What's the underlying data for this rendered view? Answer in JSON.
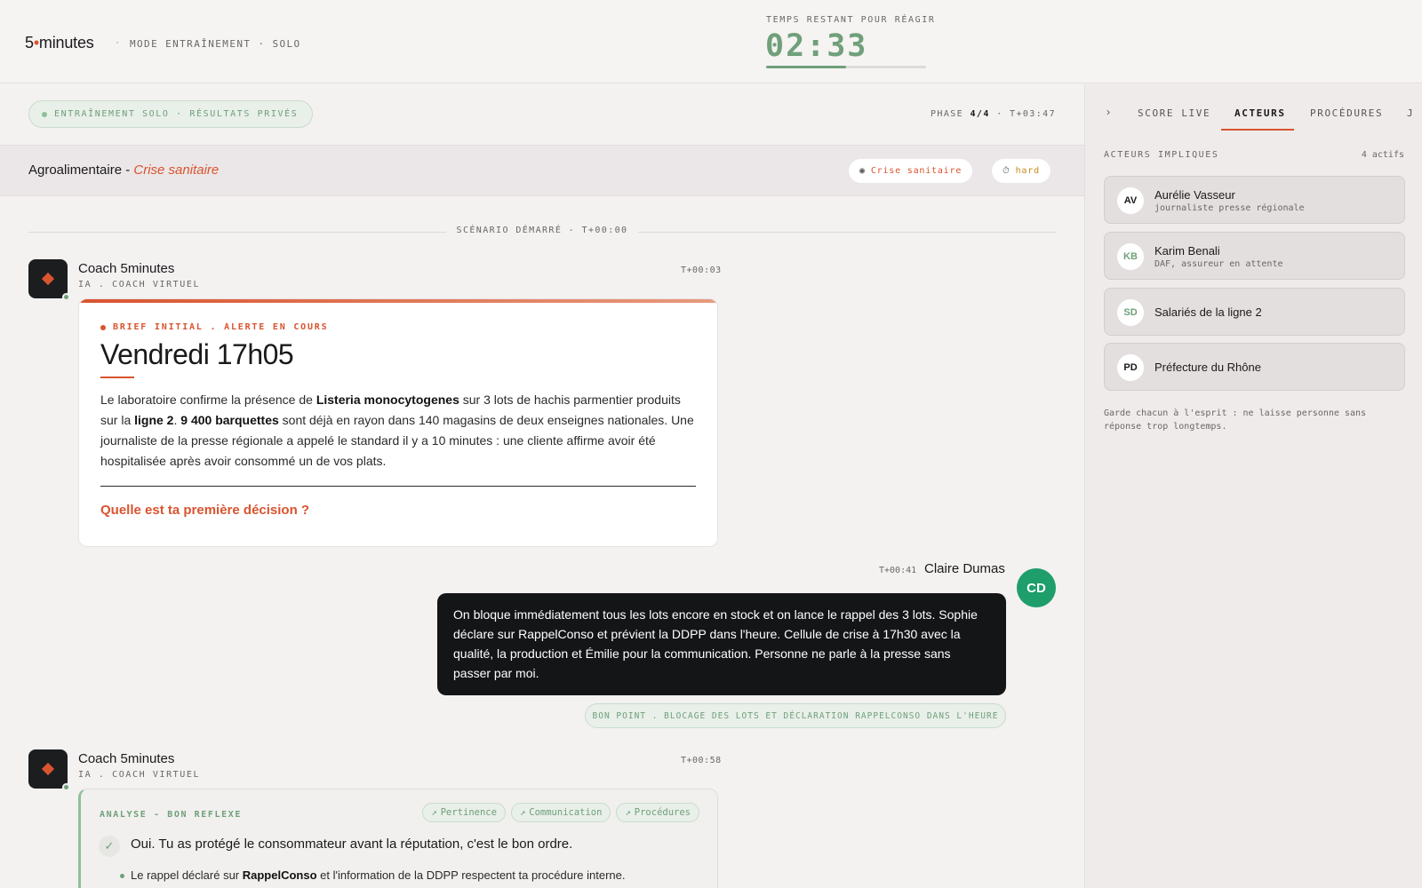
{
  "header": {
    "logo_num": "5",
    "logo_word": "minutes",
    "separator": "·",
    "mode": "MODE ENTRAÎNEMENT · SOLO",
    "timer_label": "TEMPS RESTANT POUR RÉAGIR",
    "timer": "02:33",
    "timer_progress": 0.5
  },
  "subheader": {
    "solo_pill": "ENTRAÎNEMENT SOLO · RÉSULTATS PRIVÉS",
    "phase_label": "PHASE",
    "phase_value": "4/4",
    "phase_time": "· T+03:47"
  },
  "scenario": {
    "sector": "Agroalimentaire - ",
    "crisis": "Crise sanitaire",
    "chip_crise": "Crise sanitaire",
    "chip_hard": "hard"
  },
  "chat": {
    "divider": "SCÉNARIO DÉMARRÉ - T+00:00",
    "coach_name": "Coach 5minutes",
    "coach_sub": "IA . COACH VIRTUEL",
    "msg1_ts": "T+00:03",
    "brief": {
      "label": "BRIEF INITIAL . ALERTE EN COURS",
      "title": "Vendredi 17h05",
      "t1": "Le laboratoire confirme la présence de ",
      "b1": "Listeria monocytogenes",
      "t2": " sur 3 lots de hachis parmentier produits sur la ",
      "b2": "ligne 2",
      "t3": ". ",
      "b3": "9 400 barquettes",
      "t4": " sont déjà en rayon dans 140 magasins de deux enseignes nationales. Une journaliste de la presse régionale a appelé le standard il y a 10 minutes : une cliente affirme avoir été hospitalisée après avoir consommé un de vos plats.",
      "question": "Quelle est ta première décision ?"
    },
    "user_ts": "T+00:41",
    "user_name": "Claire Dumas",
    "user_initials": "CD",
    "user_message": "On bloque immédiatement tous les lots encore en stock et on lance le rappel des 3 lots. Sophie déclare sur RappelConso et prévient la DDPP dans l'heure. Cellule de crise à 17h30 avec la qualité, la production et Émilie pour la communication. Personne ne parle à la presse sans passer par moi.",
    "bon_point": "BON POINT . BLOCAGE DES LOTS ET DÉCLARATION RAPPELCONSO DANS L'HEURE",
    "msg2_ts": "T+00:58",
    "analyse": {
      "label": "ANALYSE - BON REFLEXE",
      "tags": [
        "Pertinence",
        "Communication",
        "Procédures"
      ],
      "main": "Oui. Tu as protégé le consommateur avant la réputation, c'est le bon ordre.",
      "bullet_t1": "Le rappel déclaré sur ",
      "bullet_b1": "RappelConso",
      "bullet_t2": " et l'information de la DDPP respectent ta procédure interne."
    }
  },
  "panel": {
    "chevron": "›",
    "tabs": [
      "SCORE LIVE",
      "ACTEURS",
      "PROCÉDURES",
      "J"
    ],
    "title": "ACTEURS IMPLIQUES",
    "count": "4 actifs",
    "actors": [
      {
        "initials": "AV",
        "name": "Aurélie Vasseur",
        "role": "journaliste presse régionale",
        "color": "#1a1a1a"
      },
      {
        "initials": "KB",
        "name": "Karim Benali",
        "role": "DAF, assureur en attente",
        "color": "#6fa07a"
      },
      {
        "initials": "SD",
        "name": "Salariés de la ligne 2",
        "role": "",
        "color": "#6fa07a"
      },
      {
        "initials": "PD",
        "name": "Préfecture du Rhône",
        "role": "",
        "color": "#1a1a1a"
      }
    ],
    "note": "Garde chacun à l'esprit : ne laisse personne sans réponse trop longtemps."
  }
}
